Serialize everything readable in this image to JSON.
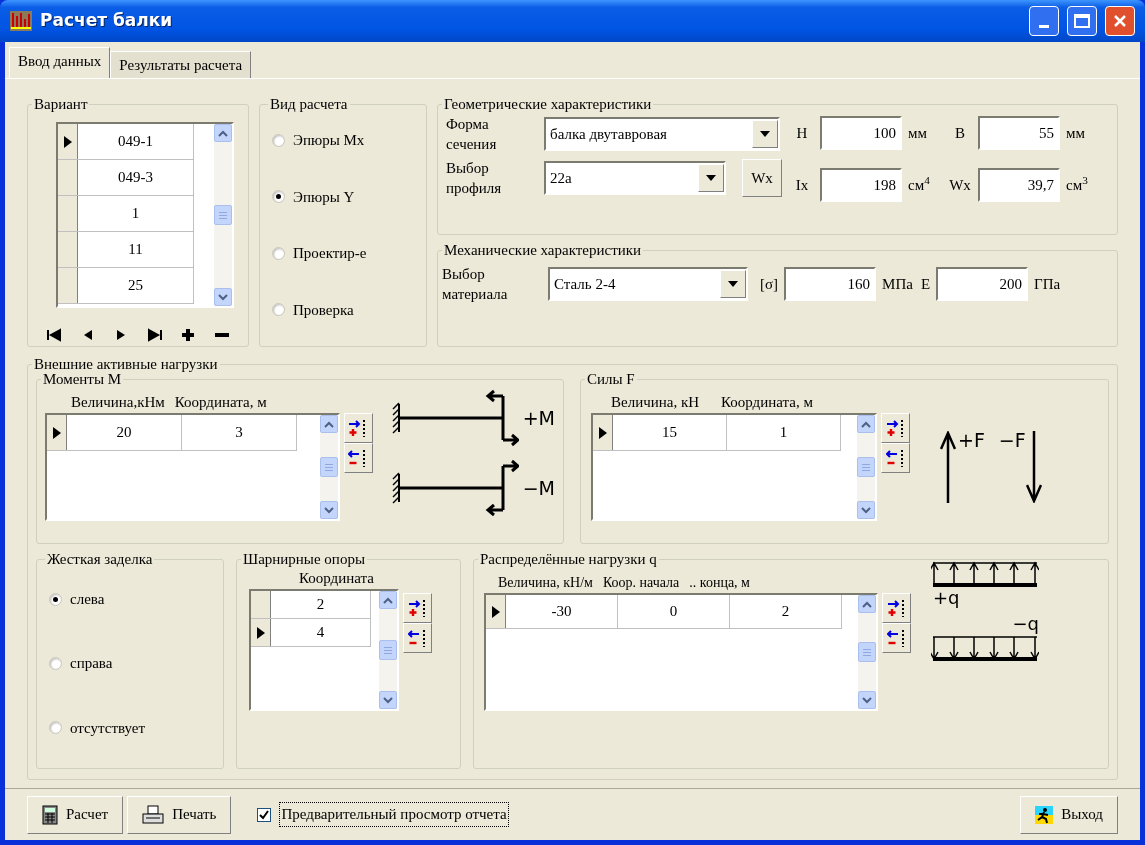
{
  "window": {
    "title": "Расчет балки"
  },
  "tabs": [
    {
      "label": "Ввод данных",
      "selected": true
    },
    {
      "label": "Результаты расчета",
      "selected": false
    }
  ],
  "variant": {
    "title": "Вариант",
    "rows": [
      {
        "cells": [
          "049-1"
        ],
        "selected": true
      },
      {
        "cells": [
          "049-3"
        ],
        "selected": false
      },
      {
        "cells": [
          "1"
        ],
        "selected": false
      },
      {
        "cells": [
          "11"
        ],
        "selected": false
      },
      {
        "cells": [
          "25"
        ],
        "selected": false
      }
    ]
  },
  "calc_type": {
    "title": "Вид расчета",
    "options": [
      {
        "label": "Эпюры Mx",
        "selected": false
      },
      {
        "label": "Эпюры Y",
        "selected": true
      },
      {
        "label": "Проектир-е",
        "selected": false
      },
      {
        "label": "Проверка",
        "selected": false
      }
    ]
  },
  "geometry": {
    "title": "Геометрические характеристики",
    "shape_label": "Форма сечения",
    "shape_value": "балка двутавровая",
    "profile_label": "Выбор профиля",
    "profile_value": "22а",
    "wx_button": "Wx",
    "params": [
      {
        "label": "H",
        "value": "100",
        "unit": "мм"
      },
      {
        "label": "B",
        "value": "55",
        "unit": "мм"
      },
      {
        "label": "Ix",
        "value": "198",
        "unit": "см$^{4}$"
      },
      {
        "label": "Wx",
        "value": "39,7",
        "unit": "см$^{3}$"
      }
    ]
  },
  "mechanics": {
    "title": "Механические характеристики",
    "material_label": "Выбор материала",
    "material_value": "Сталь 2-4",
    "params": [
      {
        "label": "[σ]",
        "value": "160",
        "unit": "МПа"
      },
      {
        "label": "E",
        "value": "200",
        "unit": "ГПа"
      }
    ]
  },
  "loads": {
    "title": "Внешние активные нагрузки",
    "moments": {
      "title": "Моменты M",
      "columns": [
        "Величина,кНм",
        "Координата, м"
      ],
      "rows": [
        {
          "cells": [
            "20",
            "3"
          ],
          "selected": true
        }
      ],
      "labels": [
        "+M",
        "−M"
      ]
    },
    "forces": {
      "title": "Силы F",
      "columns": [
        "Величина, кН",
        "Координата, м"
      ],
      "rows": [
        {
          "cells": [
            "15",
            "1"
          ],
          "selected": true
        }
      ],
      "labels": [
        "+F",
        "−F"
      ]
    },
    "fixed_support": {
      "title": "Жесткая заделка",
      "options": [
        {
          "label": "слева",
          "selected": true
        },
        {
          "label": "справа",
          "selected": false
        },
        {
          "label": "отсутствует",
          "selected": false
        }
      ]
    },
    "hinged_supports": {
      "title": "Шарнирные опоры",
      "columns": [
        "Координата"
      ],
      "rows": [
        {
          "cells": [
            "2"
          ],
          "selected": false
        },
        {
          "cells": [
            "4"
          ],
          "selected": true
        }
      ]
    },
    "distributed": {
      "title": "Распределённые нагрузки q",
      "columns": [
        "Величина, кН/м",
        "Коор. начала",
        ".. конца, м"
      ],
      "rows": [
        {
          "cells": [
            "-30",
            "0",
            "2"
          ],
          "selected": true
        }
      ],
      "labels": [
        "+q",
        "−q"
      ]
    }
  },
  "footer": {
    "buttons": [
      {
        "label": "Расчет",
        "kind": "calc"
      },
      {
        "label": "Печать",
        "kind": "print"
      }
    ],
    "preview": {
      "label": "Предварительный просмотр отчета",
      "checked": true
    },
    "exit": {
      "label": "Выход"
    }
  }
}
